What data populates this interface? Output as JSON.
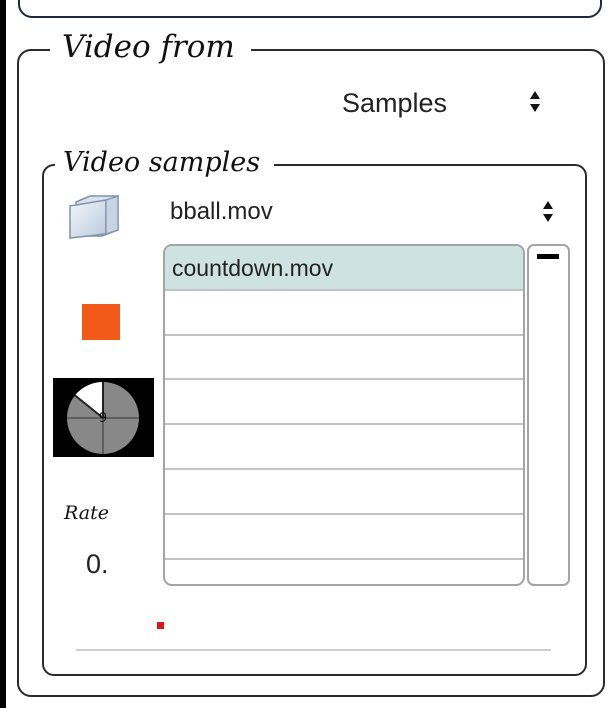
{
  "video_from": {
    "label": "Video from",
    "source": "Samples"
  },
  "video_samples": {
    "label": "Video samples",
    "selected_file": "bball.mov",
    "files": [
      "countdown.mov",
      "",
      "",
      "",
      "",
      "",
      "",
      ""
    ],
    "selected_index": 0
  },
  "rate": {
    "label": "Rate",
    "value": "0."
  },
  "colors": {
    "stop": "#f25a1a",
    "selection": "#cfe2e2",
    "record": "#d7191c"
  }
}
